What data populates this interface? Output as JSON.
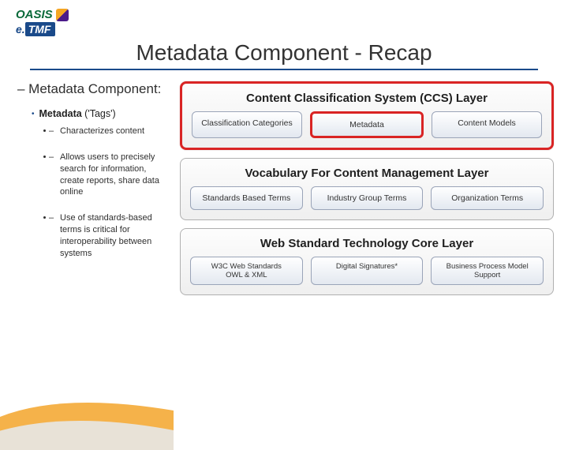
{
  "logos": {
    "oasis": "OASIS",
    "etmf_prefix": "e.",
    "etmf_main": "TMF"
  },
  "title": "Metadata Component - Recap",
  "left": {
    "section": "–  Metadata Component:",
    "meta_bold": "Metadata",
    "meta_rest": "  ('Tags')",
    "bullets": [
      "Characterizes content",
      "Allows users to precisely search for information, create reports, share data online",
      "Use of standards-based terms is critical for interoperability between systems"
    ]
  },
  "layers": [
    {
      "title": "Content Classification System (CCS) Layer",
      "highlight": true,
      "items": [
        {
          "label": "Classification Categories",
          "highlight": false
        },
        {
          "label": "Metadata",
          "highlight": true
        },
        {
          "label": "Content Models",
          "highlight": false
        }
      ]
    },
    {
      "title": "Vocabulary For Content Management Layer",
      "highlight": false,
      "items": [
        {
          "label": "Standards Based  Terms",
          "highlight": false
        },
        {
          "label": "Industry Group Terms",
          "highlight": false
        },
        {
          "label": "Organization Terms",
          "highlight": false
        }
      ]
    },
    {
      "title": "Web Standard Technology Core Layer",
      "highlight": false,
      "small": true,
      "items": [
        {
          "label": "W3C  Web Standards\nOWL & XML",
          "highlight": false
        },
        {
          "label": "Digital Signatures*",
          "highlight": false
        },
        {
          "label": "Business Process Model Support",
          "highlight": false
        }
      ]
    }
  ]
}
